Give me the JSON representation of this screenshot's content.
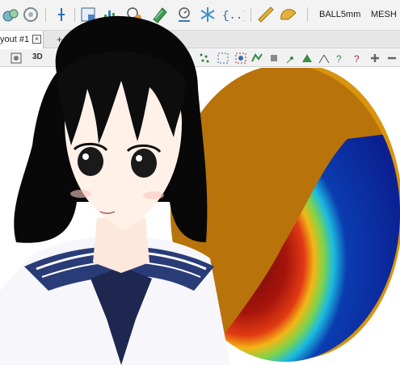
{
  "toolbar": {
    "material_label": "BALL5mm",
    "mesh_label": "MESH",
    "icons": [
      "particles-icon",
      "settings-gear-icon",
      "axis-icon",
      "window-icon",
      "chart-icon",
      "timer-icon",
      "report-icon",
      "time-icon",
      "snowflake-icon",
      "braces-icon",
      "ruler-icon",
      "protractor-icon"
    ]
  },
  "tabs": {
    "active_label": "yout #1",
    "close_glyph": "×",
    "add_glyph": "+"
  },
  "viewbar": {
    "mode_label": "3D",
    "icons": [
      "view-icon",
      "grid-icon",
      "points-icon",
      "sphere-icon",
      "contour-icon",
      "arrow-icon",
      "vertex-icon",
      "triangle-icon",
      "node-icon",
      "help-icon",
      "query-icon",
      "zoom-in-icon",
      "zoom-out-icon"
    ]
  },
  "colors": {
    "disk_face": "#b8730a",
    "disk_rim": "#d9930f",
    "cool": "#0b1f8f",
    "hot": "#7a0b08",
    "toolbar_bg": "#f3f3f3"
  }
}
